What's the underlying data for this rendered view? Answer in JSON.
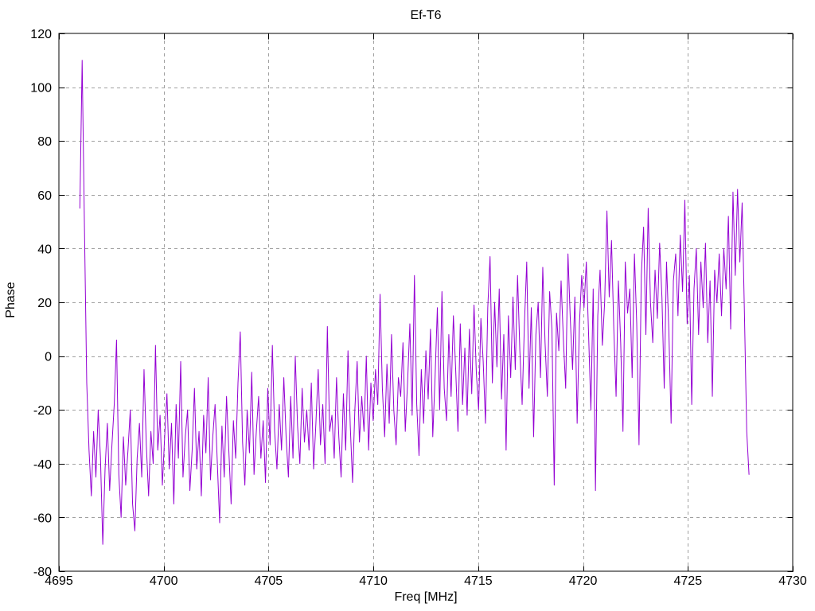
{
  "chart_data": {
    "type": "line",
    "title": "Ef-T6",
    "xlabel": "Freq [MHz]",
    "ylabel": "Phase",
    "xlim": [
      4695,
      4730
    ],
    "ylim": [
      -80,
      120
    ],
    "x_ticks": [
      4695,
      4700,
      4705,
      4710,
      4715,
      4720,
      4725,
      4730
    ],
    "y_ticks": [
      -80,
      -60,
      -40,
      -20,
      0,
      20,
      40,
      60,
      80,
      100,
      120
    ],
    "grid": "dashed-major",
    "legend": "none",
    "colors": {
      "line": "#9400d3",
      "grid": "#a0a0a0",
      "axis": "#000000",
      "background": "#ffffff"
    },
    "series": [
      {
        "x_start": 4696.0,
        "x_step": 0.1093,
        "y": [
          55,
          110,
          48,
          -10,
          -35,
          -52,
          -28,
          -45,
          -20,
          -38,
          -70,
          -42,
          -25,
          -50,
          -33,
          -18,
          6,
          -44,
          -60,
          -30,
          -48,
          -35,
          -20,
          -55,
          -65,
          -38,
          -25,
          -45,
          -5,
          -33,
          -52,
          -28,
          -40,
          4,
          -35,
          -22,
          -48,
          -30,
          -14,
          -42,
          -25,
          -55,
          -18,
          -38,
          -2,
          -45,
          -30,
          -20,
          -50,
          -35,
          -12,
          -42,
          -28,
          -52,
          -22,
          -36,
          -8,
          -46,
          -30,
          -18,
          -40,
          -62,
          -26,
          -45,
          -15,
          -35,
          -55,
          -24,
          -38,
          -10,
          9,
          -32,
          -48,
          -20,
          -36,
          -6,
          -44,
          -28,
          -15,
          -38,
          -24,
          -47,
          -12,
          -33,
          4,
          -28,
          -42,
          -18,
          -35,
          -8,
          -30,
          -45,
          -15,
          -38,
          0,
          -26,
          -40,
          -12,
          -32,
          -20,
          -35,
          -10,
          -42,
          -25,
          -5,
          -33,
          -18,
          -40,
          11,
          -28,
          -22,
          -38,
          -8,
          -30,
          -45,
          -14,
          -35,
          2,
          -26,
          -47,
          -20,
          -2,
          -32,
          -15,
          -28,
          0,
          -35,
          -10,
          -24,
          -5,
          -18,
          23,
          -12,
          -30,
          -3,
          -25,
          8,
          -20,
          -33,
          -8,
          -15,
          5,
          -28,
          -10,
          12,
          -22,
          30,
          -18,
          -37,
          -5,
          -25,
          2,
          -16,
          10,
          -30,
          -8,
          18,
          -20,
          24,
          -12,
          -24,
          8,
          -15,
          15,
          -5,
          -28,
          12,
          -18,
          3,
          -22,
          10,
          -14,
          19,
          -6,
          -20,
          14,
          -2,
          -25,
          18,
          37,
          -10,
          20,
          -4,
          25,
          -16,
          8,
          -35,
          15,
          -8,
          22,
          -5,
          30,
          2,
          -18,
          12,
          35,
          -12,
          18,
          -30,
          8,
          20,
          -8,
          33,
          5,
          -15,
          24,
          10,
          -48,
          16,
          2,
          28,
          6,
          -12,
          38,
          14,
          -5,
          22,
          -25,
          12,
          30,
          18,
          35,
          8,
          -20,
          25,
          -50,
          15,
          32,
          4,
          20,
          54,
          22,
          43,
          10,
          -15,
          28,
          5,
          -28,
          35,
          16,
          25,
          -8,
          38,
          12,
          -33,
          30,
          48,
          8,
          55,
          20,
          5,
          32,
          14,
          42,
          22,
          -12,
          35,
          10,
          -25,
          28,
          38,
          15,
          45,
          24,
          58,
          12,
          30,
          -18,
          25,
          40,
          8,
          35,
          18,
          42,
          5,
          28,
          -15,
          32,
          20,
          38,
          15,
          40,
          25,
          52,
          10,
          61,
          30,
          62,
          35,
          57,
          16,
          -28,
          -44
        ]
      }
    ]
  }
}
